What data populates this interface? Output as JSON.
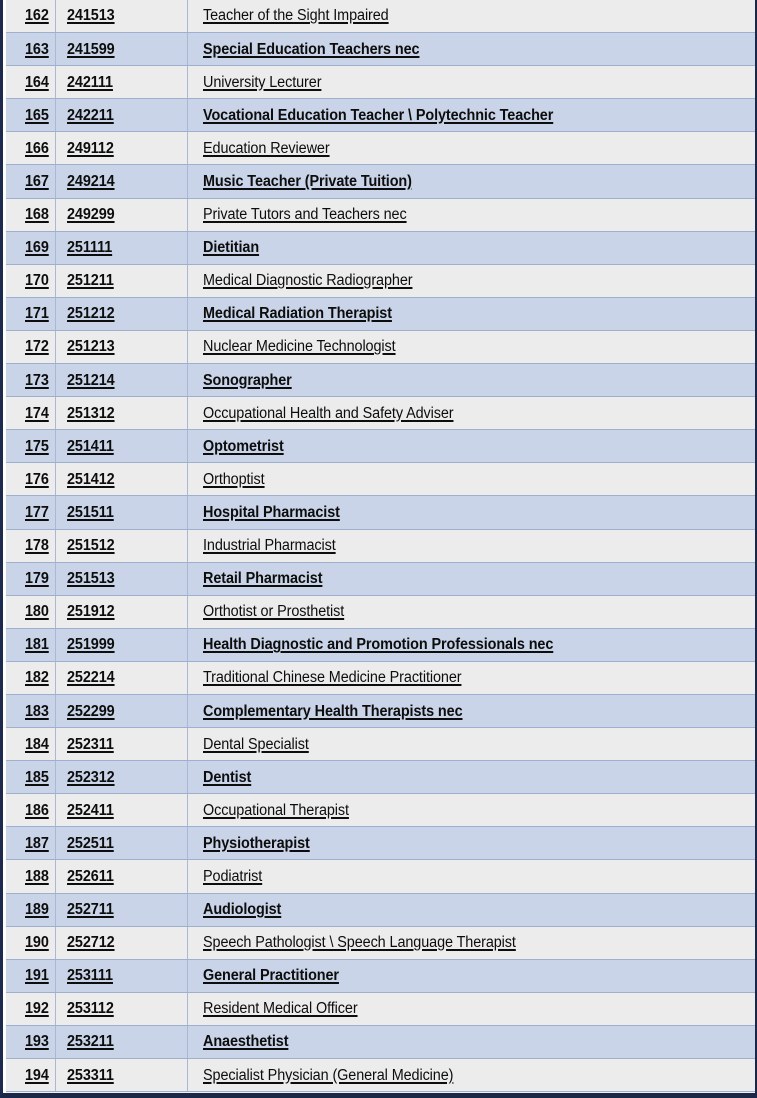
{
  "table": {
    "columns": [
      "index",
      "anzsco_code",
      "occupation_title"
    ],
    "colors": {
      "row_light": "#ececec",
      "row_blue": "#c9d4e8",
      "grid_line": "#9fb0cf",
      "frame": "#1b2748",
      "text": "#0d0d0d"
    },
    "rows": [
      {
        "index": "162",
        "code": "241513",
        "title": "Teacher of the Sight Impaired"
      },
      {
        "index": "163",
        "code": "241599",
        "title": "Special Education Teachers nec"
      },
      {
        "index": "164",
        "code": "242111",
        "title": "University Lecturer"
      },
      {
        "index": "165",
        "code": "242211",
        "title": "Vocational Education Teacher \\ Polytechnic Teacher"
      },
      {
        "index": "166",
        "code": "249112",
        "title": "Education Reviewer"
      },
      {
        "index": "167",
        "code": "249214",
        "title": "Music Teacher (Private Tuition)"
      },
      {
        "index": "168",
        "code": "249299",
        "title": "Private Tutors and Teachers nec"
      },
      {
        "index": "169",
        "code": "251111",
        "title": "Dietitian"
      },
      {
        "index": "170",
        "code": "251211",
        "title": "Medical Diagnostic Radiographer"
      },
      {
        "index": "171",
        "code": "251212",
        "title": "Medical Radiation Therapist"
      },
      {
        "index": "172",
        "code": "251213",
        "title": "Nuclear Medicine Technologist"
      },
      {
        "index": "173",
        "code": "251214",
        "title": "Sonographer"
      },
      {
        "index": "174",
        "code": "251312",
        "title": "Occupational Health and Safety Adviser"
      },
      {
        "index": "175",
        "code": "251411",
        "title": "Optometrist"
      },
      {
        "index": "176",
        "code": "251412",
        "title": "Orthoptist"
      },
      {
        "index": "177",
        "code": "251511",
        "title": "Hospital Pharmacist"
      },
      {
        "index": "178",
        "code": "251512",
        "title": "Industrial Pharmacist"
      },
      {
        "index": "179",
        "code": "251513",
        "title": "Retail Pharmacist"
      },
      {
        "index": "180",
        "code": "251912",
        "title": "Orthotist or Prosthetist"
      },
      {
        "index": "181",
        "code": "251999",
        "title": "Health Diagnostic and Promotion Professionals nec"
      },
      {
        "index": "182",
        "code": "252214",
        "title": "Traditional Chinese Medicine Practitioner"
      },
      {
        "index": "183",
        "code": "252299",
        "title": "Complementary Health Therapists nec"
      },
      {
        "index": "184",
        "code": "252311",
        "title": "Dental Specialist"
      },
      {
        "index": "185",
        "code": "252312",
        "title": "Dentist"
      },
      {
        "index": "186",
        "code": "252411",
        "title": "Occupational Therapist"
      },
      {
        "index": "187",
        "code": "252511",
        "title": "Physiotherapist"
      },
      {
        "index": "188",
        "code": "252611",
        "title": "Podiatrist"
      },
      {
        "index": "189",
        "code": "252711",
        "title": "Audiologist"
      },
      {
        "index": "190",
        "code": "252712",
        "title": "Speech Pathologist \\ Speech Language Therapist"
      },
      {
        "index": "191",
        "code": "253111",
        "title": "General Practitioner"
      },
      {
        "index": "192",
        "code": "253112",
        "title": "Resident Medical Officer"
      },
      {
        "index": "193",
        "code": "253211",
        "title": "Anaesthetist"
      },
      {
        "index": "194",
        "code": "253311",
        "title": "Specialist Physician (General Medicine)"
      }
    ]
  }
}
